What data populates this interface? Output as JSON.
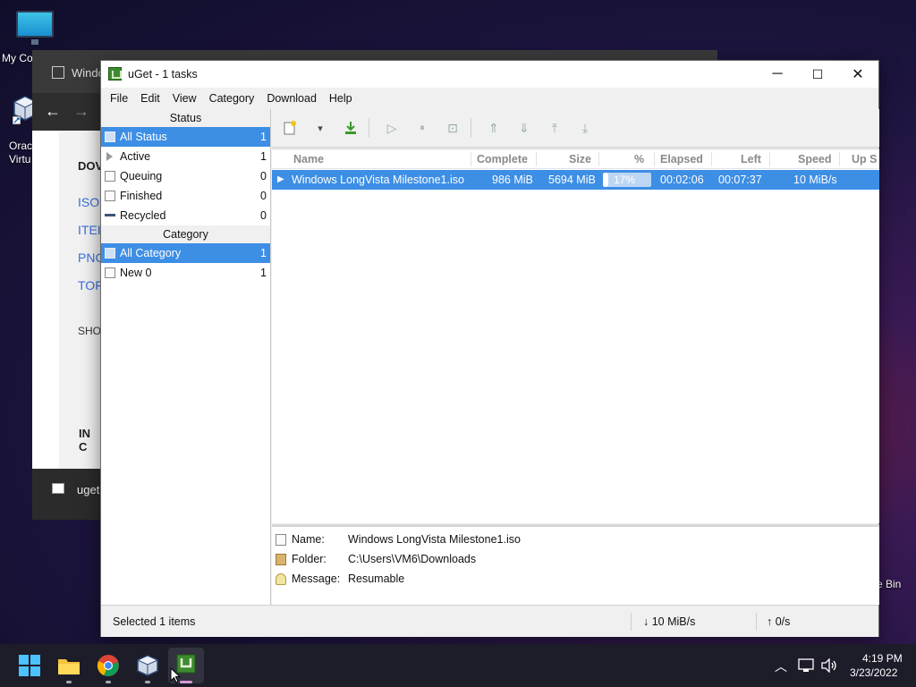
{
  "desktop": {
    "icons": [
      {
        "label": "My Co",
        "icon": "monitor-icon"
      },
      {
        "label": "Orac Virtu",
        "icon": "virtualbox-icon"
      },
      {
        "label": "e Bin",
        "icon": "recycle-bin-icon"
      }
    ]
  },
  "background_window": {
    "title": "Windo",
    "links": [
      "ISO",
      "ITEI",
      "PNC",
      "TOF"
    ],
    "texts": [
      "DOV",
      "SHO",
      "IN C"
    ],
    "taskbar_label": "uget"
  },
  "window": {
    "title": "uGet - 1 tasks",
    "controls": {
      "minimize": "─",
      "maximize": "☐",
      "close": "✕"
    }
  },
  "menu": [
    "File",
    "Edit",
    "View",
    "Category",
    "Download",
    "Help"
  ],
  "sidebar": {
    "status_header": "Status",
    "status_items": [
      {
        "label": "All Status",
        "count": "1",
        "icon": "all-status-icon",
        "selected": true
      },
      {
        "label": "Active",
        "count": "1",
        "icon": "play-icon",
        "selected": false
      },
      {
        "label": "Queuing",
        "count": "0",
        "icon": "queue-icon",
        "selected": false
      },
      {
        "label": "Finished",
        "count": "0",
        "icon": "finished-icon",
        "selected": false
      },
      {
        "label": "Recycled",
        "count": "0",
        "icon": "recycled-icon",
        "selected": false
      }
    ],
    "category_header": "Category",
    "category_items": [
      {
        "label": "All Category",
        "count": "1",
        "icon": "all-category-icon",
        "selected": true
      },
      {
        "label": "New 0",
        "count": "1",
        "icon": "category-icon",
        "selected": false
      }
    ]
  },
  "toolbar": {
    "buttons": [
      {
        "name": "new-download",
        "glyph": "🗋"
      },
      {
        "name": "new-dropdown",
        "glyph": "▾"
      },
      {
        "name": "save",
        "glyph": "⤓"
      },
      {
        "name": "start",
        "glyph": "▷"
      },
      {
        "name": "pause",
        "glyph": "⏸"
      },
      {
        "name": "properties",
        "glyph": "⊡"
      },
      {
        "name": "move-up",
        "glyph": "⇑"
      },
      {
        "name": "move-down",
        "glyph": "⇓"
      },
      {
        "name": "move-top",
        "glyph": "⤒"
      },
      {
        "name": "move-bottom",
        "glyph": "⤓"
      }
    ]
  },
  "tasks": {
    "columns": [
      "Name",
      "Complete",
      "Size",
      "%",
      "Elapsed",
      "Left",
      "Speed",
      "Up S"
    ],
    "rows": [
      {
        "name": "Windows LongVista Milestone1.iso",
        "complete": "986 MiB",
        "size": "5694 MiB",
        "percent": "17%",
        "progress": 0.17,
        "elapsed": "00:02:06",
        "left": "00:07:37",
        "speed": "10 MiB/s"
      }
    ]
  },
  "detail": {
    "name_label": "Name:",
    "name_value": "Windows LongVista Milestone1.iso",
    "folder_label": "Folder:",
    "folder_value": "C:\\Users\\VM6\\Downloads",
    "message_label": "Message:",
    "message_value": "Resumable"
  },
  "statusbar": {
    "selected": "Selected 1 items",
    "down_speed": "↓ 10 MiB/s",
    "up_speed": "↑ 0/s"
  },
  "taskbar": {
    "time": "4:19 PM",
    "date": "3/23/2022",
    "apps": [
      "start-icon",
      "file-explorer-icon",
      "chrome-icon",
      "virtualbox-icon",
      "uget-icon"
    ]
  },
  "colors": {
    "selection": "#3d8ee5",
    "uget_green": "#3e8a2f"
  }
}
